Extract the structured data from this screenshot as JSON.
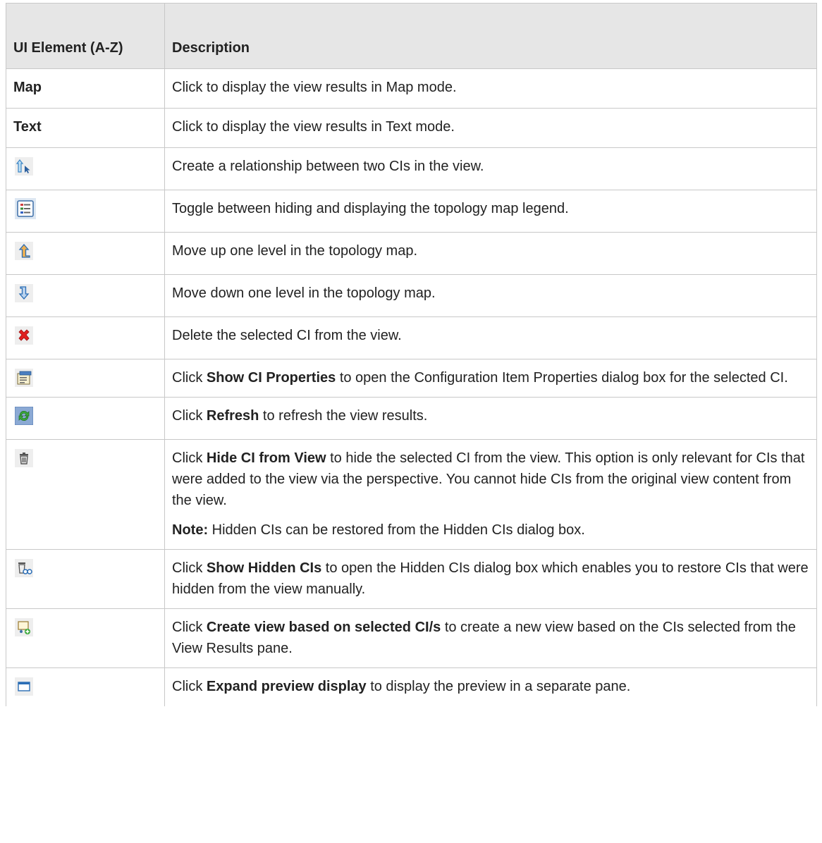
{
  "table": {
    "header": {
      "col1": "UI Element (A-Z)",
      "col2": "Description"
    },
    "rows": [
      {
        "element": "Map",
        "description": "Click to display the view results in Map mode."
      },
      {
        "element": "Text",
        "description": "Click to display the view results in Text mode."
      },
      {
        "icon": "create-relationship-icon",
        "description": "Create a relationship between two CIs in the view."
      },
      {
        "icon": "legend-toggle-icon",
        "description": "Toggle between hiding and displaying the topology map legend."
      },
      {
        "icon": "level-up-icon",
        "description": "Move up one level in the topology map."
      },
      {
        "icon": "level-down-icon",
        "description": "Move down one level in the topology map."
      },
      {
        "icon": "delete-icon",
        "description": "Delete the selected CI from the view."
      },
      {
        "icon": "properties-icon",
        "desc_pre": "Click ",
        "desc_bold": "Show CI Properties",
        "desc_post": " to open the Configuration Item Properties dialog box for the selected CI."
      },
      {
        "icon": "refresh-icon",
        "desc_pre": "Click ",
        "desc_bold": "Refresh",
        "desc_post": " to refresh the view results."
      },
      {
        "icon": "trash-icon",
        "desc_pre": "Click ",
        "desc_bold": "Hide CI from View",
        "desc_post": " to hide the selected CI from the view. This option is only relevant for CIs that were added to the view via the perspective. You cannot hide CIs from the original view content from the view.",
        "note_bold": "Note:",
        "note_text": " Hidden CIs can be restored from the Hidden CIs dialog box."
      },
      {
        "icon": "show-hidden-icon",
        "desc_pre": "Click ",
        "desc_bold": "Show Hidden CIs",
        "desc_post": " to open the Hidden CIs dialog box which enables you to restore CIs that were hidden from the view manually."
      },
      {
        "icon": "create-view-icon",
        "desc_pre": "Click ",
        "desc_bold": "Create view based on selected CI/s",
        "desc_post": " to create a new view based on the CIs selected from the View Results pane."
      },
      {
        "icon": "expand-preview-icon",
        "desc_pre": "Click ",
        "desc_bold": "Expand preview display",
        "desc_post": " to display the preview in a separate pane."
      }
    ]
  }
}
